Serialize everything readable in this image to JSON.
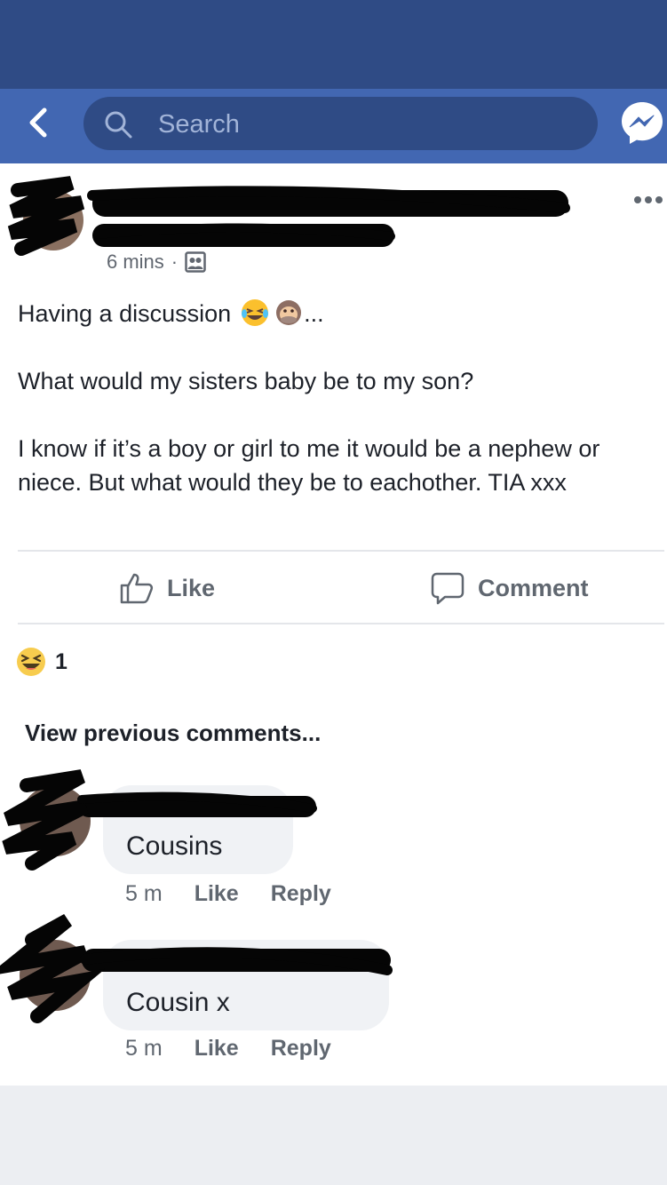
{
  "search": {
    "placeholder": "Search"
  },
  "post": {
    "time": "6 mins",
    "separator": "·",
    "text_line1": "Having a discussion",
    "text_line1_suffix": "...",
    "text_para2": "What would my sisters baby be to my son?",
    "text_para3": "I know if it’s a boy or girl to me it would be a nephew or niece. But what would they be to eachother. TIA xxx",
    "emojis": [
      "tears-of-joy-emoji",
      "speak-no-evil-monkey-emoji"
    ]
  },
  "actions": {
    "like": "Like",
    "comment": "Comment"
  },
  "reactions": {
    "icon": "haha-reaction-icon",
    "count": "1"
  },
  "comments_section": {
    "view_previous": "View previous comments...",
    "comments": [
      {
        "text": "Cousins",
        "time": "5 m",
        "like": "Like",
        "reply": "Reply"
      },
      {
        "text": "Cousin x",
        "time": "5 m",
        "like": "Like",
        "reply": "Reply"
      }
    ]
  },
  "colors": {
    "status_bar": "#2f4b85",
    "nav_bar": "#4267b2",
    "search_box": "#2f4b85",
    "bubble": "#f0f2f5",
    "muted_text": "#606770"
  }
}
